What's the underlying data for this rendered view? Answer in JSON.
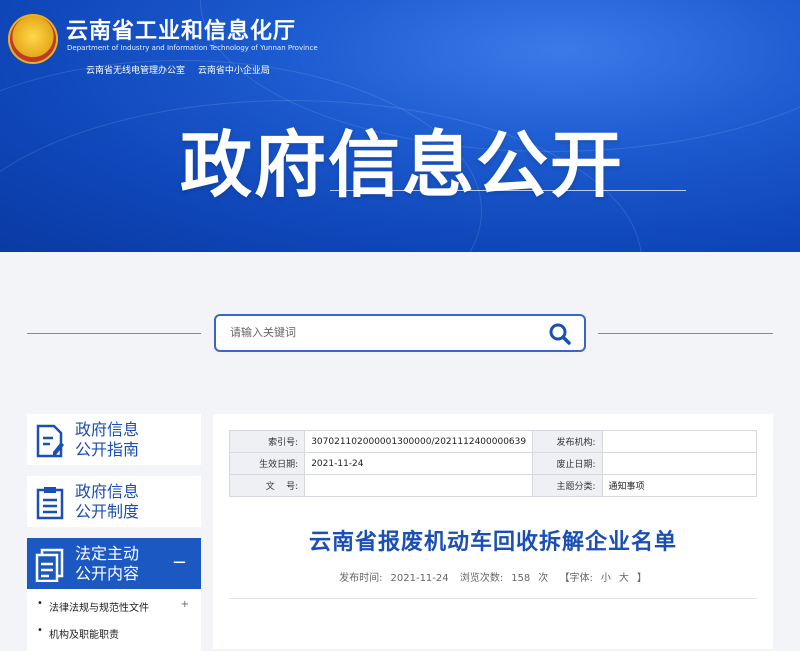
{
  "header": {
    "org_cn": "云南省工业和信息化厅",
    "org_en": "Department of Industry and Information Technology of Yunnan Province",
    "sub_links": [
      "云南省无线电管理办公室",
      "云南省中小企业局"
    ],
    "banner_title": "政府信息公开"
  },
  "search": {
    "placeholder": "请输入关键词"
  },
  "sidebar": {
    "items": [
      {
        "line1": "政府信息",
        "line2": "公开指南",
        "icon": "document-edit-icon"
      },
      {
        "line1": "政府信息",
        "line2": "公开制度",
        "icon": "document-list-icon"
      },
      {
        "line1": "法定主动",
        "line2": "公开内容",
        "icon": "documents-icon",
        "toggle": "−"
      }
    ],
    "subitems": [
      {
        "label": "法律法规与规范性文件",
        "toggle": "+"
      },
      {
        "label": "机构及职能职责"
      }
    ]
  },
  "meta": {
    "index_label": "索引号:",
    "index_value": "307021102000001300000/2021112400000639",
    "publisher_label": "发布机构:",
    "publisher_value": "",
    "date_label": "生效日期:",
    "date_value": "2021-11-24",
    "expire_label": "废止日期:",
    "expire_value": "",
    "docno_label": "文    号:",
    "docno_value": "",
    "category_label": "主题分类:",
    "category_value": "通知事项"
  },
  "article": {
    "title": "云南省报废机动车回收拆解企业名单",
    "publish_label": "发布时间:",
    "publish_date": "2021-11-24",
    "views_label": "浏览次数:",
    "views_count": "158",
    "views_unit": "次",
    "font_label": "【字体:",
    "font_small": "小",
    "font_large": "大",
    "font_close": "】"
  },
  "colors": {
    "banner": "#1c5bd0",
    "accent": "#1a4fb5",
    "active_nav": "#1c58c2"
  }
}
